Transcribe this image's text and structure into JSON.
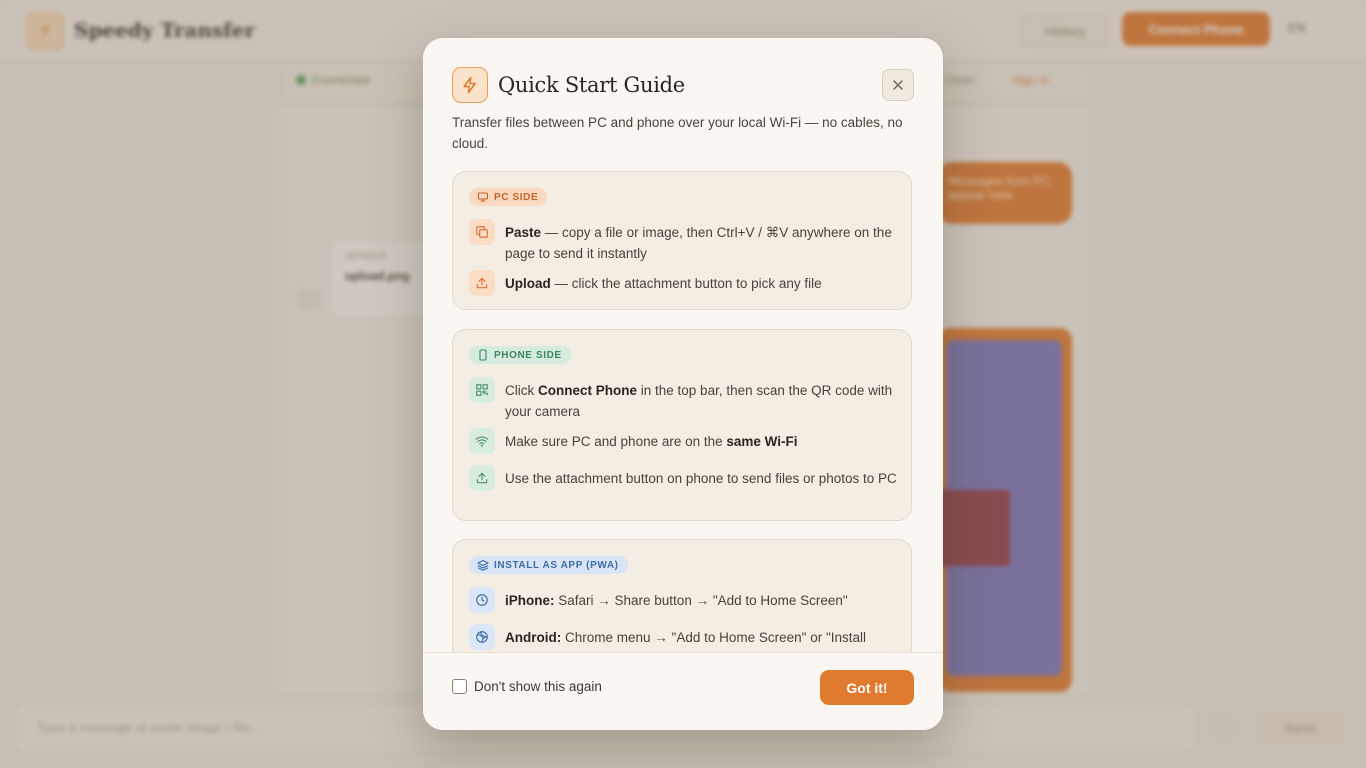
{
  "background": {
    "brand": "Speedy Transfer",
    "history_label": "History",
    "connect_label": "Connect Phone",
    "lang_label": "EN",
    "status_label": "Connected",
    "sub_right_1": "Clean",
    "sub_right_2": "Sign in",
    "bubble_text": "Messages from PC appear here",
    "card_title": "SENDER",
    "card_name": "upload.png",
    "input_placeholder": "Type a message or paste image / file...",
    "send_label": "Send"
  },
  "modal": {
    "title": "Quick Start Guide",
    "description": "Transfer files between PC and phone over your local Wi-Fi — no cables, no cloud.",
    "pc_section": {
      "badge": "PC SIDE",
      "items": [
        {
          "bold": "Paste",
          "text": " — copy a file or image, then Ctrl+V / ⌘V anywhere on the page to send it instantly",
          "icon": "copy-icon"
        },
        {
          "bold": "Upload",
          "text": " — click the attachment button to pick any file",
          "icon": "upload-icon"
        }
      ]
    },
    "phone_section": {
      "badge": "PHONE SIDE",
      "items": [
        {
          "pre": "Click ",
          "bold": "Connect Phone",
          "post": " in the top bar, then scan the QR code with your camera",
          "icon": "qr-code-icon"
        },
        {
          "pre": "Make sure PC and phone are on the ",
          "bold": "same Wi-Fi",
          "post": "",
          "icon": "wifi-icon"
        },
        {
          "pre": "Use the attachment button on phone to send files or photos to PC",
          "bold": "",
          "post": "",
          "icon": "upload-icon"
        }
      ]
    },
    "pwa_section": {
      "badge": "INSTALL AS APP (PWA)",
      "items": [
        {
          "bold": "iPhone:",
          "text": " Safari → Share button → \"Add to Home Screen\"",
          "icon": "compass-icon"
        },
        {
          "bold": "Android:",
          "text": " Chrome menu → \"Add to Home Screen\" or \"Install app\"",
          "icon": "chrome-icon"
        }
      ]
    },
    "footer": {
      "dont_show_label": "Don't show this again",
      "dont_show_checked": false,
      "got_it_label": "Got it!"
    }
  },
  "colors": {
    "accent": "#e07a2e",
    "pc_badge": "#c66325",
    "phone_badge": "#3f8560",
    "pwa_badge": "#3f6ea6"
  }
}
